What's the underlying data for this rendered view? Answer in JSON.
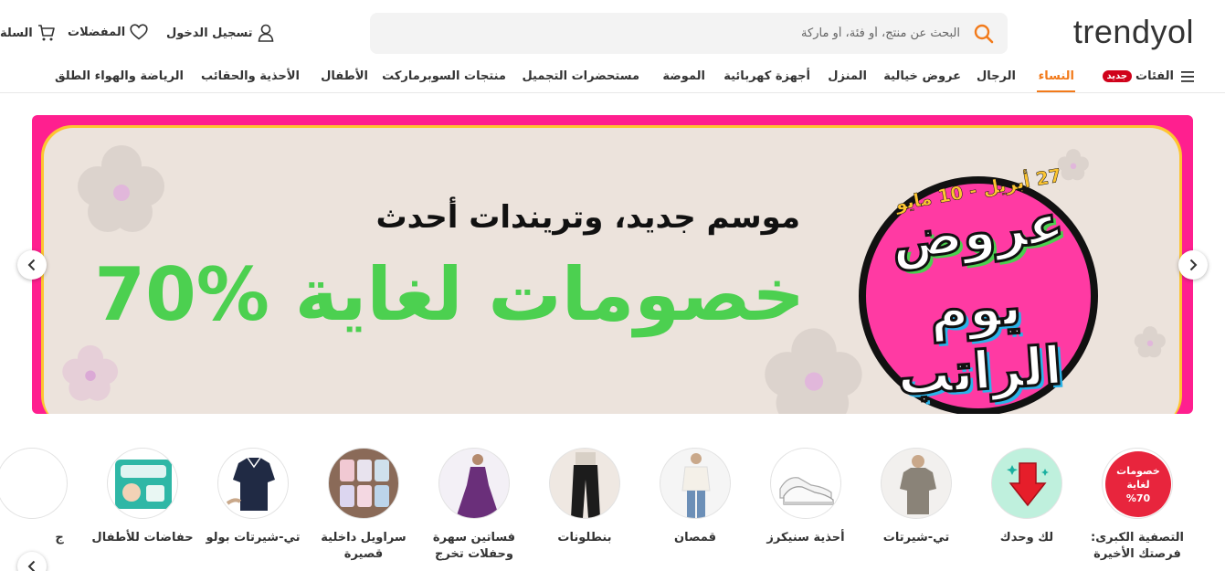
{
  "header": {
    "logo": "trendyol",
    "search_placeholder": "البحث عن منتج، أو فئة، أو ماركة",
    "login": "تسجيل الدخول",
    "favorites": "المفضلات",
    "cart": "السلة"
  },
  "nav": {
    "categories_label": "الفئات",
    "new_badge": "جديد",
    "items": [
      {
        "label": "النساء",
        "active": true
      },
      {
        "label": "الرجال"
      },
      {
        "label": "عروض خيالية"
      },
      {
        "label": "المنزل"
      },
      {
        "label": "أجهزة كهربائية"
      },
      {
        "label": "الموضة"
      },
      {
        "label": "مستحضرات التجميل"
      },
      {
        "label": "منتجات السوبرماركت"
      },
      {
        "label": "الأطفال"
      },
      {
        "label": "الأحذية والحقائب"
      },
      {
        "label": "الرياضة والهواء الطلق"
      }
    ]
  },
  "banner": {
    "subtitle": "موسم جديد، وتريندات أحدث",
    "headline": "خصومات لغاية %70",
    "badge_date": "27 أبريل - 10 مايو",
    "badge_line1": "عروض",
    "badge_line2": "يوم الراتب",
    "colors": {
      "border": "#ff1f8f",
      "frame": "#fdc531",
      "background": "#ece3dc",
      "green": "#4cd050"
    }
  },
  "categories": [
    {
      "label": "التصفية الكبرى: فرصتك الأخيرة",
      "icon": "sale-badge-icon",
      "badge_text": "خصومات لغاية 70%"
    },
    {
      "label": "لك وحدك",
      "icon": "down-arrow-gift-icon"
    },
    {
      "label": "تي-شيرتات",
      "icon": "tshirt-photo"
    },
    {
      "label": "أحذية سنيكرز",
      "icon": "sneakers-photo"
    },
    {
      "label": "قمصان",
      "icon": "shirt-photo"
    },
    {
      "label": "بنطلونات",
      "icon": "pants-photo"
    },
    {
      "label": "فساتين سهرة وحفلات تخرج",
      "icon": "evening-dress-photo"
    },
    {
      "label": "سراويل داخلية قصيرة",
      "icon": "underwear-photo"
    },
    {
      "label": "تي-شيرتات بولو",
      "icon": "polo-photo"
    },
    {
      "label": "حفاضات للأطفال",
      "icon": "diapers-photo"
    },
    {
      "label": "ج",
      "icon": "partial-photo"
    }
  ],
  "brand_color": "#f27a1a"
}
